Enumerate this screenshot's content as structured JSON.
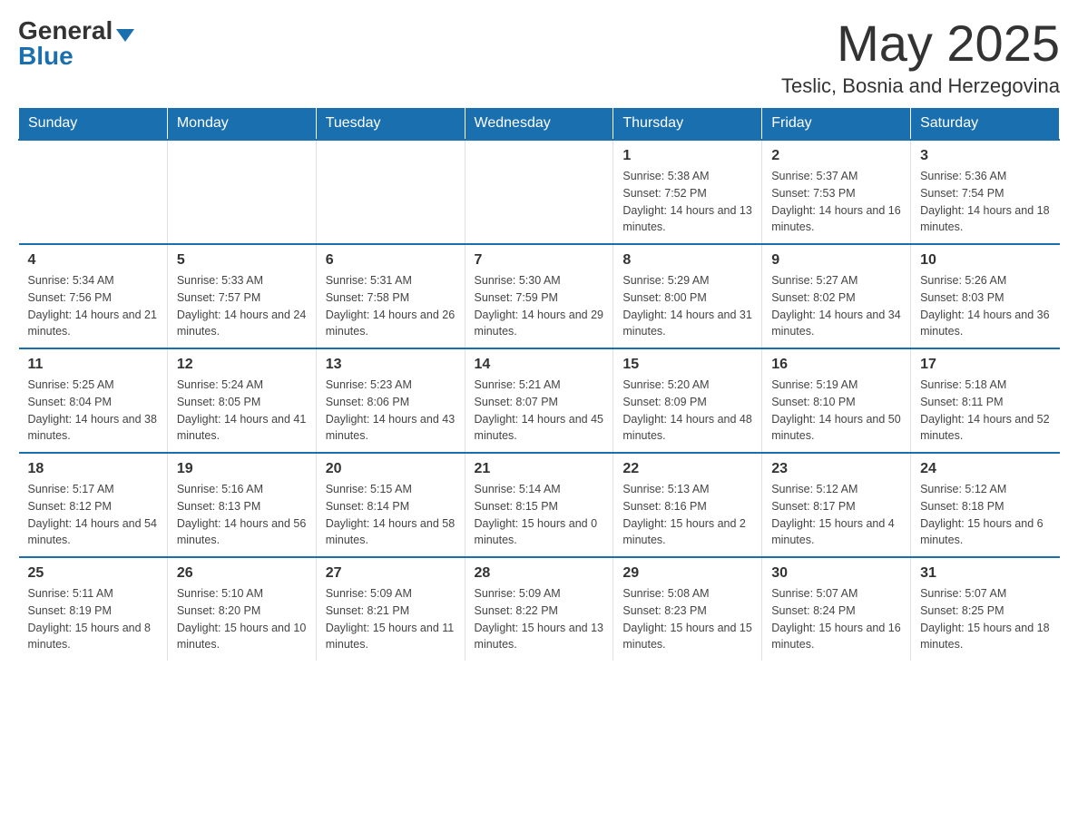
{
  "header": {
    "logo_general": "General",
    "logo_blue": "Blue",
    "month_title": "May 2025",
    "location": "Teslic, Bosnia and Herzegovina"
  },
  "days_of_week": [
    "Sunday",
    "Monday",
    "Tuesday",
    "Wednesday",
    "Thursday",
    "Friday",
    "Saturday"
  ],
  "weeks": [
    [
      {
        "day": "",
        "info": ""
      },
      {
        "day": "",
        "info": ""
      },
      {
        "day": "",
        "info": ""
      },
      {
        "day": "",
        "info": ""
      },
      {
        "day": "1",
        "info": "Sunrise: 5:38 AM\nSunset: 7:52 PM\nDaylight: 14 hours and 13 minutes."
      },
      {
        "day": "2",
        "info": "Sunrise: 5:37 AM\nSunset: 7:53 PM\nDaylight: 14 hours and 16 minutes."
      },
      {
        "day": "3",
        "info": "Sunrise: 5:36 AM\nSunset: 7:54 PM\nDaylight: 14 hours and 18 minutes."
      }
    ],
    [
      {
        "day": "4",
        "info": "Sunrise: 5:34 AM\nSunset: 7:56 PM\nDaylight: 14 hours and 21 minutes."
      },
      {
        "day": "5",
        "info": "Sunrise: 5:33 AM\nSunset: 7:57 PM\nDaylight: 14 hours and 24 minutes."
      },
      {
        "day": "6",
        "info": "Sunrise: 5:31 AM\nSunset: 7:58 PM\nDaylight: 14 hours and 26 minutes."
      },
      {
        "day": "7",
        "info": "Sunrise: 5:30 AM\nSunset: 7:59 PM\nDaylight: 14 hours and 29 minutes."
      },
      {
        "day": "8",
        "info": "Sunrise: 5:29 AM\nSunset: 8:00 PM\nDaylight: 14 hours and 31 minutes."
      },
      {
        "day": "9",
        "info": "Sunrise: 5:27 AM\nSunset: 8:02 PM\nDaylight: 14 hours and 34 minutes."
      },
      {
        "day": "10",
        "info": "Sunrise: 5:26 AM\nSunset: 8:03 PM\nDaylight: 14 hours and 36 minutes."
      }
    ],
    [
      {
        "day": "11",
        "info": "Sunrise: 5:25 AM\nSunset: 8:04 PM\nDaylight: 14 hours and 38 minutes."
      },
      {
        "day": "12",
        "info": "Sunrise: 5:24 AM\nSunset: 8:05 PM\nDaylight: 14 hours and 41 minutes."
      },
      {
        "day": "13",
        "info": "Sunrise: 5:23 AM\nSunset: 8:06 PM\nDaylight: 14 hours and 43 minutes."
      },
      {
        "day": "14",
        "info": "Sunrise: 5:21 AM\nSunset: 8:07 PM\nDaylight: 14 hours and 45 minutes."
      },
      {
        "day": "15",
        "info": "Sunrise: 5:20 AM\nSunset: 8:09 PM\nDaylight: 14 hours and 48 minutes."
      },
      {
        "day": "16",
        "info": "Sunrise: 5:19 AM\nSunset: 8:10 PM\nDaylight: 14 hours and 50 minutes."
      },
      {
        "day": "17",
        "info": "Sunrise: 5:18 AM\nSunset: 8:11 PM\nDaylight: 14 hours and 52 minutes."
      }
    ],
    [
      {
        "day": "18",
        "info": "Sunrise: 5:17 AM\nSunset: 8:12 PM\nDaylight: 14 hours and 54 minutes."
      },
      {
        "day": "19",
        "info": "Sunrise: 5:16 AM\nSunset: 8:13 PM\nDaylight: 14 hours and 56 minutes."
      },
      {
        "day": "20",
        "info": "Sunrise: 5:15 AM\nSunset: 8:14 PM\nDaylight: 14 hours and 58 minutes."
      },
      {
        "day": "21",
        "info": "Sunrise: 5:14 AM\nSunset: 8:15 PM\nDaylight: 15 hours and 0 minutes."
      },
      {
        "day": "22",
        "info": "Sunrise: 5:13 AM\nSunset: 8:16 PM\nDaylight: 15 hours and 2 minutes."
      },
      {
        "day": "23",
        "info": "Sunrise: 5:12 AM\nSunset: 8:17 PM\nDaylight: 15 hours and 4 minutes."
      },
      {
        "day": "24",
        "info": "Sunrise: 5:12 AM\nSunset: 8:18 PM\nDaylight: 15 hours and 6 minutes."
      }
    ],
    [
      {
        "day": "25",
        "info": "Sunrise: 5:11 AM\nSunset: 8:19 PM\nDaylight: 15 hours and 8 minutes."
      },
      {
        "day": "26",
        "info": "Sunrise: 5:10 AM\nSunset: 8:20 PM\nDaylight: 15 hours and 10 minutes."
      },
      {
        "day": "27",
        "info": "Sunrise: 5:09 AM\nSunset: 8:21 PM\nDaylight: 15 hours and 11 minutes."
      },
      {
        "day": "28",
        "info": "Sunrise: 5:09 AM\nSunset: 8:22 PM\nDaylight: 15 hours and 13 minutes."
      },
      {
        "day": "29",
        "info": "Sunrise: 5:08 AM\nSunset: 8:23 PM\nDaylight: 15 hours and 15 minutes."
      },
      {
        "day": "30",
        "info": "Sunrise: 5:07 AM\nSunset: 8:24 PM\nDaylight: 15 hours and 16 minutes."
      },
      {
        "day": "31",
        "info": "Sunrise: 5:07 AM\nSunset: 8:25 PM\nDaylight: 15 hours and 18 minutes."
      }
    ]
  ]
}
